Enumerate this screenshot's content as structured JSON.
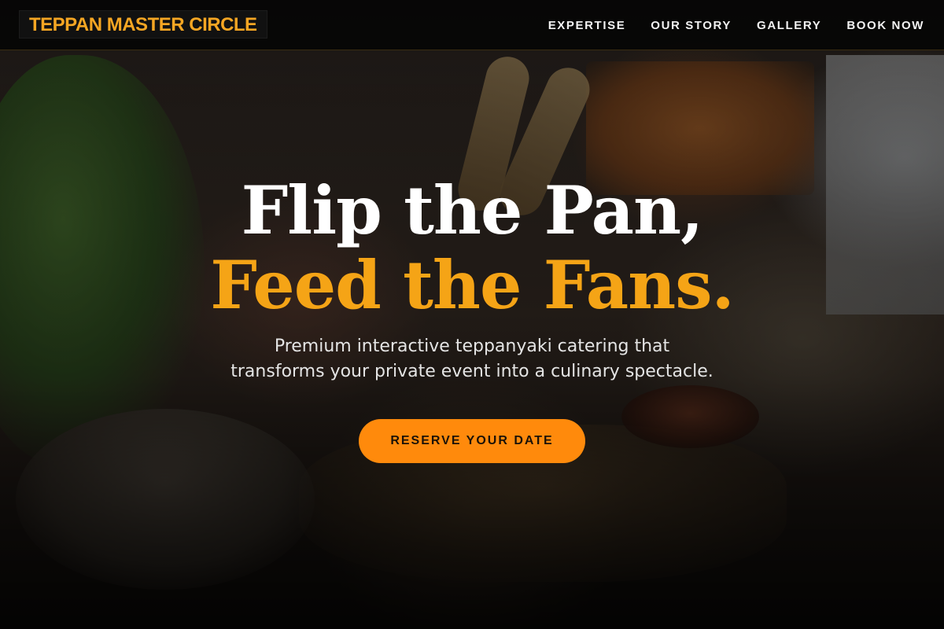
{
  "brand": {
    "name": "TEPPAN MASTER CIRCLE"
  },
  "nav": {
    "items": [
      {
        "label": "EXPERTISE"
      },
      {
        "label": "OUR STORY"
      },
      {
        "label": "GALLERY"
      },
      {
        "label": "BOOK NOW"
      }
    ]
  },
  "hero": {
    "headline_line1": "Flip the Pan,",
    "headline_line2": "Feed the Fans.",
    "subtitle_line1": "Premium interactive teppanyaki catering that",
    "subtitle_line2": "transforms your private event into a culinary spectacle.",
    "cta_label": "RESERVE YOUR DATE"
  },
  "colors": {
    "accent": "#f5a416",
    "button": "#ff8a0c",
    "header_bg": "#050505"
  }
}
